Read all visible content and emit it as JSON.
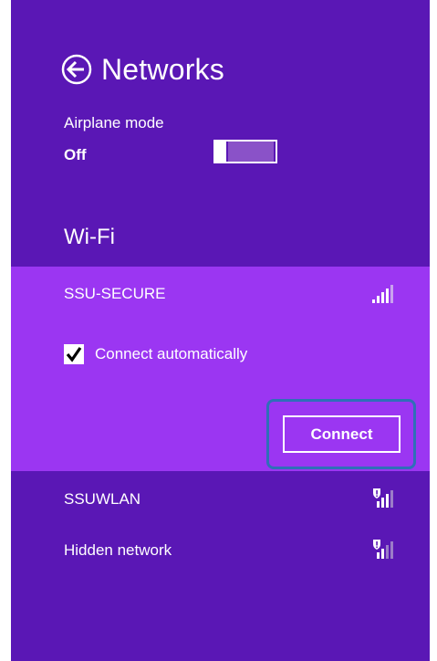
{
  "header": {
    "title": "Networks",
    "back_icon": "back-arrow-circle-icon"
  },
  "airplane_mode": {
    "label": "Airplane mode",
    "state": "Off"
  },
  "wifi": {
    "heading": "Wi-Fi",
    "networks": [
      {
        "name": "SSU-SECURE",
        "selected": true,
        "secured": false,
        "signal_icon": "signal-bars-icon",
        "connect_automatically_label": "Connect automatically",
        "connect_automatically_checked": true,
        "connect_label": "Connect"
      },
      {
        "name": "SSUWLAN",
        "selected": false,
        "secured": true,
        "signal_icon": "signal-bars-shield-icon"
      },
      {
        "name": "Hidden network",
        "selected": false,
        "secured": true,
        "signal_icon": "signal-bars-shield-icon"
      }
    ]
  },
  "colors": {
    "pane_background": "#5a17b5",
    "selected_network_background": "#9b36f2",
    "focus_ring": "#2f6fb8",
    "text": "#ffffff"
  }
}
